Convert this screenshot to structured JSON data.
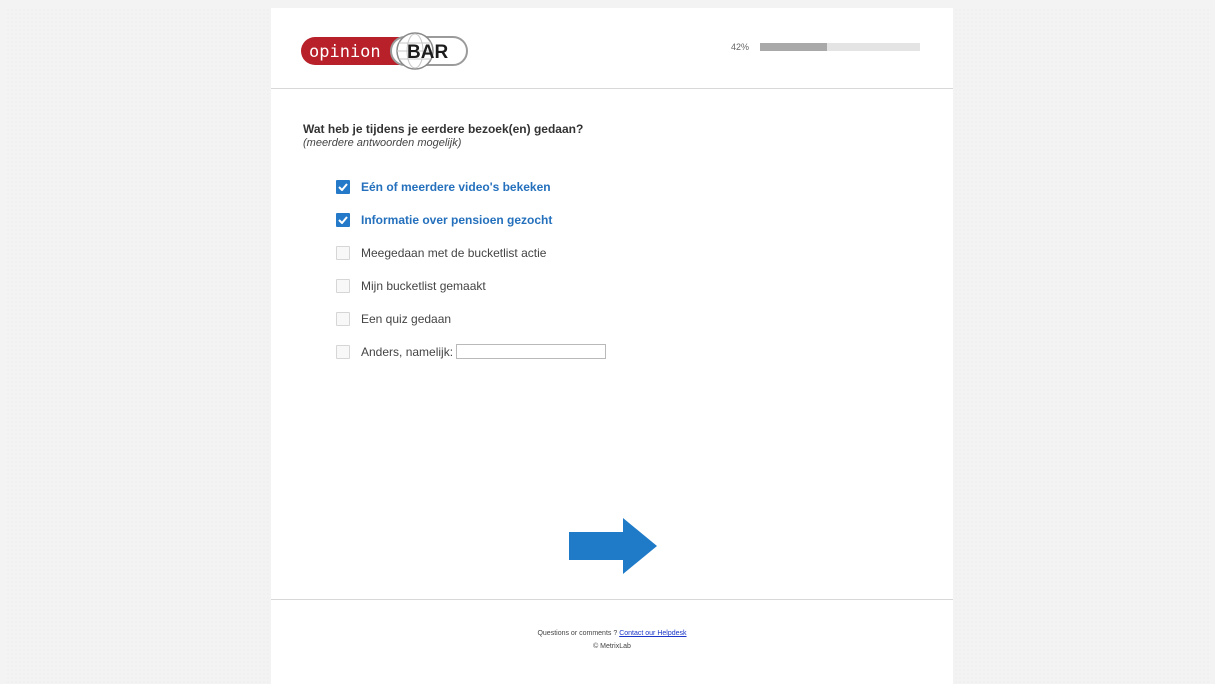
{
  "logo": {
    "left_text": "opinion",
    "right_text": "BAR",
    "colors": {
      "red": "#b8202a",
      "grey": "#9b9b9b"
    }
  },
  "progress": {
    "label": "42%",
    "fraction": 0.42,
    "fill_color": "#a9a9a9"
  },
  "question": {
    "title": "Wat heb je tijdens je eerdere bezoek(en) gedaan?",
    "subtitle": "(meerdere antwoorden mogelijk)"
  },
  "options": [
    {
      "label": "Eén of meerdere video's bekeken",
      "checked": true
    },
    {
      "label": "Informatie over pensioen gezocht",
      "checked": true
    },
    {
      "label": "Meegedaan met de bucketlist actie",
      "checked": false
    },
    {
      "label": "Mijn bucketlist gemaakt",
      "checked": false
    },
    {
      "label": "Een quiz gedaan",
      "checked": false
    },
    {
      "label": "Anders, namelijk:",
      "checked": false,
      "has_text_input": true,
      "input_value": ""
    }
  ],
  "next_button": {
    "icon": "arrow-right-icon",
    "color": "#1f7bc8"
  },
  "footer": {
    "question_text": "Questions or comments ?",
    "helpdesk_link": "Contact our Helpdesk",
    "copyright": "© MetrixLab"
  }
}
